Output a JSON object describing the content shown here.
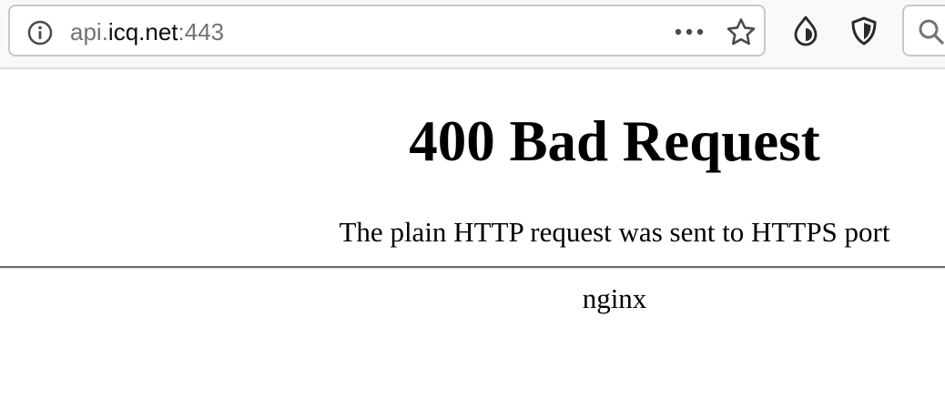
{
  "browser": {
    "url": {
      "prefix": "api.",
      "host": "icq.net",
      "port": ":443"
    },
    "icons": {
      "site_info": "info-icon",
      "page_actions": "more-icon",
      "bookmark": "star-icon",
      "extension": "droplet-icon",
      "privacy": "shield-icon",
      "search": "search-icon"
    }
  },
  "page": {
    "title": "400 Bad Request",
    "message": "The plain HTTP request was sent to HTTPS port",
    "server": "nginx"
  }
}
